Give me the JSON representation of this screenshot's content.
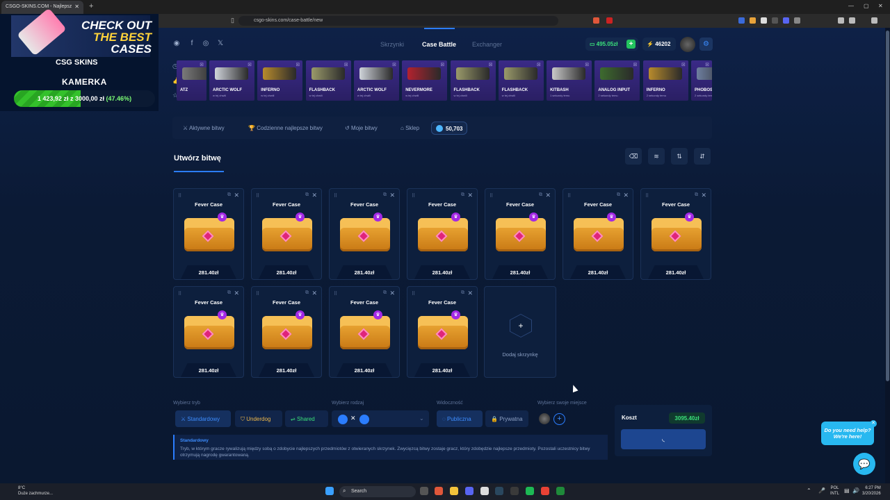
{
  "browser": {
    "tab_title": "CSGO-SKINS.COM - Najlepsz",
    "url": "csgo-skins.com/case-battle/new"
  },
  "promo": {
    "title_line1": "CHECK OUT",
    "title_line2": "THE BEST",
    "title_line3": "CASES",
    "brand": "CSG SKINS",
    "streamer": "KAMERKA",
    "goal_current": "1 423,92 zł",
    "goal_sep": "z",
    "goal_target": "3000,00 zł",
    "goal_pct_text": "(47.46%)",
    "goal_pct": 0.4746
  },
  "nav": {
    "tabs": [
      "Skrzynki",
      "Case Battle",
      "Exchanger"
    ],
    "balance": "495.05zł",
    "coins": "46202"
  },
  "drops": [
    {
      "name": "ATZ",
      "sub": "",
      "color": "#7a7a7a"
    },
    {
      "name": "ARCTIC WOLF",
      "sub": "w tej chwili",
      "color": "#cfd3da"
    },
    {
      "name": "INFERNO",
      "sub": "w tej chwili",
      "color": "#b88b2c"
    },
    {
      "name": "FLASHBACK",
      "sub": "w tej chwili",
      "color": "#9a9a6a"
    },
    {
      "name": "ARCTIC WOLF",
      "sub": "w tej chwili",
      "color": "#cfd3da"
    },
    {
      "name": "NEVERMORE",
      "sub": "w tej chwili",
      "color": "#b3222f"
    },
    {
      "name": "FLASHBACK",
      "sub": "w tej chwili",
      "color": "#9a9a6a"
    },
    {
      "name": "FLASHBACK",
      "sub": "w tej chwili",
      "color": "#9a9a6a"
    },
    {
      "name": "KITBASH",
      "sub": "1 sekundy temu",
      "color": "#c9c9c9"
    },
    {
      "name": "ANALOG INPUT",
      "sub": "2 sekundy temu",
      "color": "#3d6b2e"
    },
    {
      "name": "INFERNO",
      "sub": "2 sekundy temu",
      "color": "#b88b2c"
    },
    {
      "name": "PHOBOS",
      "sub": "2 sekundy temu",
      "color": "#6e7fa0"
    }
  ],
  "battle_tabs": {
    "active": "Aktywne bitwy",
    "daily": "Codzienne najlepsze bitwy",
    "mine": "Moje bitwy",
    "shop": "Sklep",
    "shop_count": "50,703"
  },
  "page_title": "Utwórz bitwę",
  "cases": [
    {
      "title": "Fever Case",
      "price": "281.40zł"
    },
    {
      "title": "Fever Case",
      "price": "281.40zł"
    },
    {
      "title": "Fever Case",
      "price": "281.40zł"
    },
    {
      "title": "Fever Case",
      "price": "281.40zł"
    },
    {
      "title": "Fever Case",
      "price": "281.40zł"
    },
    {
      "title": "Fever Case",
      "price": "281.40zł"
    },
    {
      "title": "Fever Case",
      "price": "281.40zł"
    },
    {
      "title": "Fever Case",
      "price": "281.40zł"
    },
    {
      "title": "Fever Case",
      "price": "281.40zł"
    },
    {
      "title": "Fever Case",
      "price": "281.40zł"
    },
    {
      "title": "Fever Case",
      "price": "281.40zł"
    }
  ],
  "add_case_label": "Dodaj skrzynkę",
  "settings": {
    "mode_label": "Wybierz tryb",
    "modes": [
      "Standardowy",
      "Underdog",
      "Shared"
    ],
    "kind_label": "Wybierz rodzaj",
    "vis_label": "Widoczność",
    "vis_public": "Publiczna",
    "vis_private": "Prywatna",
    "seat_label": "Wybierz swoje miejsce"
  },
  "description": {
    "title": "Standardowy",
    "text": "Tryb, w którym gracze rywalizują między sobą o zdobycie najlepszych przedmiotów z otwieranych skrzynek. Zwycięzcą bitwy zostaje gracz, który zdobędzie najlepsze przedmioty. Pozostali uczestnicy bitwy otrzymują nagrodę gwarantowaną."
  },
  "cost": {
    "label": "Koszt",
    "value": "3095.40zł"
  },
  "help": {
    "line1": "Do you need help?",
    "line2": "We're here!"
  },
  "taskbar": {
    "weather_temp": "8°C",
    "weather_desc": "Duże zachmurze...",
    "search": "Search",
    "lang1": "POL",
    "lang2": "INTL",
    "time": "6:27 PM",
    "date": "3/20/2026"
  }
}
